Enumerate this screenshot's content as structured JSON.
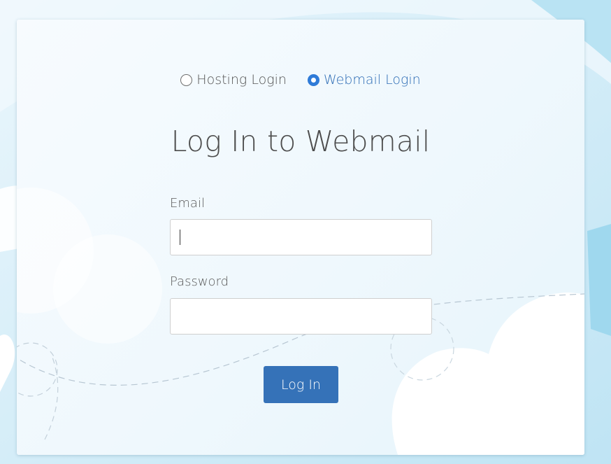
{
  "login_type": {
    "options": [
      {
        "label": "Hosting Login",
        "selected": false
      },
      {
        "label": "Webmail Login",
        "selected": true
      }
    ]
  },
  "page": {
    "title": "Log In to Webmail"
  },
  "form": {
    "email_label": "Email",
    "email_value": "",
    "password_label": "Password",
    "password_value": "",
    "submit_label": "Log In"
  },
  "colors": {
    "accent": "#2f7bd8",
    "button": "#3572b8",
    "title_text": "#4d4d4d",
    "background": "#d6eef8"
  }
}
